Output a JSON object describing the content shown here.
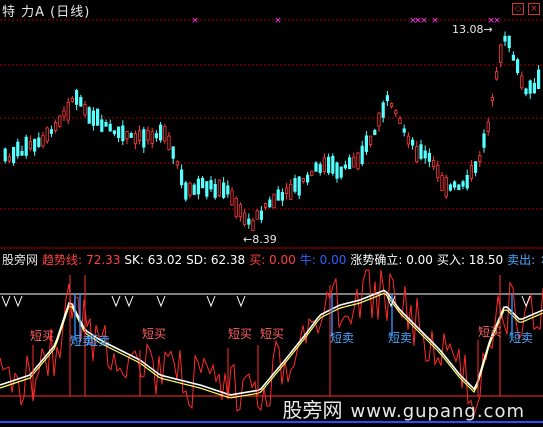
{
  "header": {
    "title": "特 力A (日线)",
    "controls": [
      "◇",
      "×"
    ]
  },
  "price_panel": {
    "high_label": "13.08",
    "low_label": "8.39",
    "colors": {
      "up": "#ff3b3b",
      "down": "#55ffff",
      "grid": "#a00000",
      "marker": "#ff40ff"
    }
  },
  "indicator_bar": {
    "items": [
      {
        "label": "股旁网",
        "color": "#e6e6e6"
      },
      {
        "label": "趋势线:",
        "color": "#ff4040"
      },
      {
        "label": "72.33",
        "color": "#ff4040"
      },
      {
        "label": "SK: 63.02",
        "color": "#ffffff"
      },
      {
        "label": "SD: 62.38",
        "color": "#ffffff"
      },
      {
        "label": "买: 0.00",
        "color": "#ff4040"
      },
      {
        "label": "牛: 0.00",
        "color": "#3060ff"
      },
      {
        "label": "涨势确立: 0.00",
        "color": "#ffffff"
      },
      {
        "label": "买入: 18.50",
        "color": "#ffffff"
      },
      {
        "label": "卖出: ↕",
        "color": "#4aa6ff"
      }
    ]
  },
  "signals": {
    "buy": "短买",
    "sell": "短卖"
  },
  "watermark": {
    "cn": "股旁网",
    "domain": "www.gupang.com"
  }
}
